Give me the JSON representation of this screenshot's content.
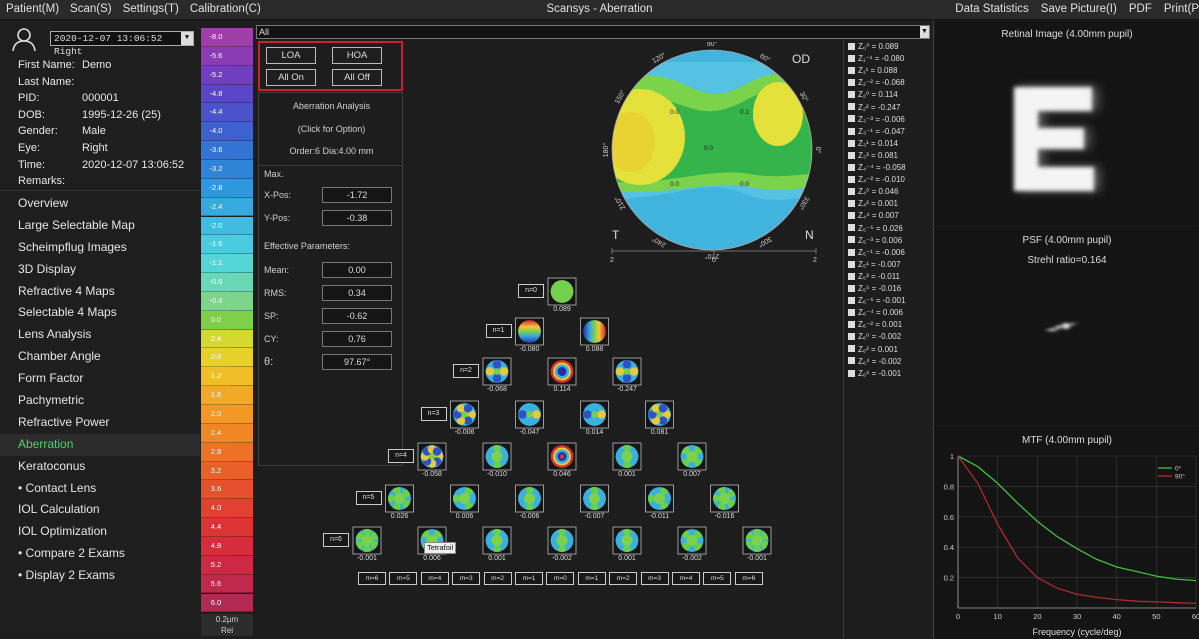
{
  "window": {
    "menu": [
      "Patient(M)",
      "Scan(S)",
      "Settings(T)",
      "Calibration(C)"
    ],
    "title": "Scansys - Aberration",
    "right_menu": [
      "Data Statistics",
      "Save Picture(I)",
      "PDF",
      "Print(P"
    ]
  },
  "patient": {
    "exam": "2020-12-07 13:06:52 Right",
    "fields": [
      {
        "k": "First Name:",
        "v": "Demo"
      },
      {
        "k": "Last Name:",
        "v": ""
      },
      {
        "k": "PID:",
        "v": "000001"
      },
      {
        "k": "DOB:",
        "v": "1995-12-26 (25)"
      },
      {
        "k": "Gender:",
        "v": "Male"
      },
      {
        "k": "Eye:",
        "v": "Right"
      },
      {
        "k": "Time:",
        "v": "2020-12-07 13:06:52"
      },
      {
        "k": "Remarks:",
        "v": ""
      }
    ]
  },
  "nav": {
    "items": [
      "Overview",
      "Large Selectable Map",
      "Scheimpflug Images",
      "3D Display",
      "Refractive 4 Maps",
      "Selectable 4 Maps",
      "Lens Analysis",
      "Chamber Angle",
      "Form Factor",
      "Pachymetric",
      "Refractive Power",
      "Aberration",
      "Keratoconus",
      "• Contact Lens",
      "IOL Calculation",
      "IOL Optimization",
      "• Compare 2 Exams",
      "• Display 2 Exams"
    ],
    "active": "Aberration"
  },
  "scale": {
    "labels": [
      "-8.0",
      "-5.6",
      "-5.2",
      "-4.8",
      "-4.4",
      "-4.0",
      "-3.6",
      "-3.2",
      "-2.8",
      "-2.4",
      "-2.0",
      "-1.6",
      "-1.2",
      "-0.8",
      "-0.4",
      "0.0",
      "0.4",
      "0.8",
      "1.2",
      "1.6",
      "2.0",
      "2.4",
      "2.8",
      "3.2",
      "3.6",
      "4.0",
      "4.4",
      "4.8",
      "5.2",
      "5.6",
      "6.0"
    ],
    "colors": [
      "#9e3fa8",
      "#8a3cb4",
      "#6f3fc0",
      "#5a45c8",
      "#4a52cc",
      "#3d62d0",
      "#3473d4",
      "#2f84d8",
      "#2f97dc",
      "#36aadf",
      "#40bce0",
      "#4bcbe0",
      "#55d6d6",
      "#6ad8b6",
      "#7fd48c",
      "#7fd048",
      "#d6d832",
      "#e8d02a",
      "#f0be28",
      "#f2aa26",
      "#f29824",
      "#f08624",
      "#ee7226",
      "#ea6028",
      "#e6502c",
      "#e24030",
      "#dc3434",
      "#d62c3c",
      "#cc2a44",
      "#c0284c",
      "#b42854"
    ],
    "unit": "0.2µm",
    "mode": "Rel"
  },
  "toolbar": {
    "all_label": "All"
  },
  "controls": {
    "loa": "LOA",
    "hoa": "HOA",
    "all_on": "All On",
    "all_off": "All Off"
  },
  "analysis": {
    "title": "Aberration Analysis",
    "click": "(Click for Option)",
    "order": "Order:6  Dia:4.00 mm",
    "max_label": "Max.",
    "xpos_label": "X-Pos:",
    "xpos": "-1.72",
    "ypos_label": "Y-Pos:",
    "ypos": "-0.38",
    "eff_label": "Effective Parameters:",
    "mean_label": "Mean:",
    "mean": "0.00",
    "rms_label": "RMS:",
    "rms": "0.34",
    "sp_label": "SP:",
    "sp": "-0.62",
    "cy_label": "CY:",
    "cy": "0.76",
    "theta_label": "θ:",
    "theta": "97.67°"
  },
  "map": {
    "eye": "OD",
    "temporal": "T",
    "nasal": "N",
    "angles": [
      "0°",
      "30°",
      "60°",
      "90°",
      "120°",
      "150°",
      "180°",
      "210°",
      "240°",
      "270°",
      "300°",
      "330°"
    ],
    "values": [
      "0.0",
      "0.1",
      "0.0",
      "0.0",
      "0.0"
    ],
    "axis_ticks": [
      "2",
      "0",
      "2"
    ]
  },
  "pyramid": {
    "row_labels": [
      "n=0",
      "n=1",
      "n=2",
      "n=3",
      "n=4",
      "n=5",
      "n=6"
    ],
    "values": [
      [
        "0.089"
      ],
      [
        "-0.080",
        "0.088"
      ],
      [
        "-0.068",
        "0.114",
        "-0.247"
      ],
      [
        "-0.006",
        "-0.047",
        "0.014",
        "0.081"
      ],
      [
        "-0.058",
        "-0.010",
        "0.046",
        "0.001",
        "0.007"
      ],
      [
        "0.026",
        "0.006",
        "-0.006",
        "-0.007",
        "-0.011",
        "-0.016"
      ],
      [
        "-0.001",
        "0.006",
        "0.001",
        "-0.002",
        "0.001",
        "-0.002",
        "-0.001"
      ]
    ],
    "tooltip": "Tetrafoil",
    "m_labels": [
      "m=6",
      "m=5",
      "m=4",
      "m=3",
      "m=2",
      "m=1",
      "m=0",
      "m=1",
      "m=2",
      "m=3",
      "m=4",
      "m=5",
      "m=6"
    ]
  },
  "zernike": [
    {
      "term": "Z₀⁰",
      "value": "= 0.089"
    },
    {
      "term": "Z₁⁻¹",
      "value": "= -0.080"
    },
    {
      "term": "Z₁¹",
      "value": "= 0.088"
    },
    {
      "term": "Z₂⁻²",
      "value": "= -0.068"
    },
    {
      "term": "Z₂⁰",
      "value": "= 0.114"
    },
    {
      "term": "Z₂²",
      "value": "= -0.247"
    },
    {
      "term": "Z₃⁻³",
      "value": "= -0.006"
    },
    {
      "term": "Z₃⁻¹",
      "value": "= -0.047"
    },
    {
      "term": "Z₃¹",
      "value": "= 0.014"
    },
    {
      "term": "Z₃³",
      "value": "= 0.081"
    },
    {
      "term": "Z₄⁻⁴",
      "value": "= -0.058"
    },
    {
      "term": "Z₄⁻²",
      "value": "= -0.010"
    },
    {
      "term": "Z₄⁰",
      "value": "= 0.046"
    },
    {
      "term": "Z₄²",
      "value": "= 0.001"
    },
    {
      "term": "Z₄⁴",
      "value": "= 0.007"
    },
    {
      "term": "Z₅⁻⁵",
      "value": "= 0.026"
    },
    {
      "term": "Z₅⁻³",
      "value": "= 0.006"
    },
    {
      "term": "Z₅⁻¹",
      "value": "= -0.006"
    },
    {
      "term": "Z₅¹",
      "value": "= -0.007"
    },
    {
      "term": "Z₅³",
      "value": "= -0.011"
    },
    {
      "term": "Z₅⁵",
      "value": "= -0.016"
    },
    {
      "term": "Z₆⁻⁶",
      "value": "= -0.001"
    },
    {
      "term": "Z₆⁻⁴",
      "value": "= 0.006"
    },
    {
      "term": "Z₆⁻²",
      "value": "= 0.001"
    },
    {
      "term": "Z₆⁰",
      "value": "= -0.002"
    },
    {
      "term": "Z₆²",
      "value": "= 0.001"
    },
    {
      "term": "Z₆⁴",
      "value": "= -0.002"
    },
    {
      "term": "Z₆⁶",
      "value": "= -0.001"
    }
  ],
  "retinal": {
    "title": "Retinal Image (4.00mm pupil)",
    "letter": "E"
  },
  "psf": {
    "title": "PSF (4.00mm pupil)",
    "strehl": "Strehl ratio=0.164"
  },
  "chart_data": {
    "type": "line",
    "title": "MTF (4.00mm pupil)",
    "xlabel": "Frequency (cycle/deg)",
    "ylabel": "",
    "xlim": [
      0,
      60
    ],
    "ylim": [
      0,
      1
    ],
    "x_ticks": [
      0,
      10,
      20,
      30,
      40,
      50,
      60
    ],
    "y_ticks": [
      0.2,
      0.4,
      0.6,
      0.8,
      1
    ],
    "legend": "top-right",
    "x": [
      0,
      5,
      10,
      15,
      20,
      25,
      30,
      35,
      40,
      45,
      50,
      55,
      60
    ],
    "series": [
      {
        "name": "0°",
        "color": "#3fbf3f",
        "values": [
          1.0,
          0.93,
          0.82,
          0.69,
          0.57,
          0.47,
          0.39,
          0.32,
          0.27,
          0.24,
          0.21,
          0.19,
          0.18
        ]
      },
      {
        "name": "90°",
        "color": "#b0282e",
        "values": [
          1.0,
          0.82,
          0.55,
          0.33,
          0.2,
          0.13,
          0.09,
          0.07,
          0.055,
          0.045,
          0.04,
          0.035,
          0.03
        ]
      }
    ]
  }
}
